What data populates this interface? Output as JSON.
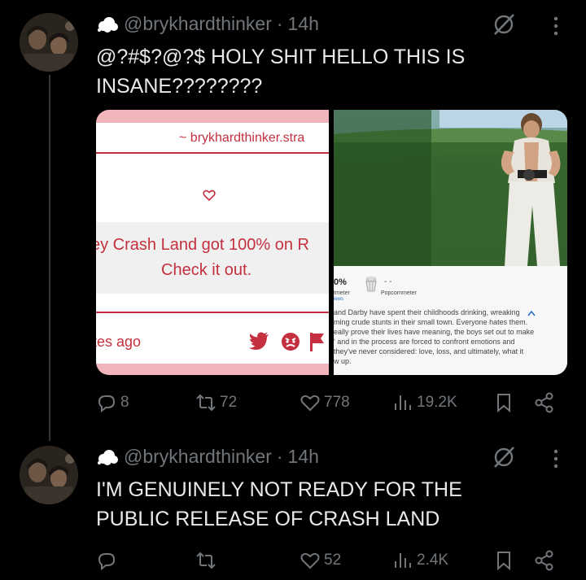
{
  "tweets": [
    {
      "handle": "@brykhardthinker",
      "separator": "·",
      "time": "14h",
      "lines": [
        "@?#$?@?$ HOLY SHIT HELLO THIS IS",
        "INSANE????????"
      ],
      "stats": {
        "replies": "8",
        "retweets": "72",
        "likes": "778",
        "views": "19.2K"
      }
    },
    {
      "handle": "@brykhardthinker",
      "separator": "·",
      "time": "14h",
      "lines": [
        "I'M GENUINELY NOT READY FOR THE",
        "PUBLIC RELEASE OF CRASH LAND"
      ],
      "stats": {
        "replies": "",
        "retweets": "",
        "likes": "52",
        "views": "2.4K"
      }
    }
  ],
  "media": {
    "left_card": {
      "handle_line": "~ brykhardthinker.stra",
      "message_line1": "ey Crash Land got 100% on R",
      "message_line2": "Check it out.",
      "time_line": "tes ago"
    },
    "right_panel": {
      "score": "0%",
      "score_label": "tmeter",
      "popcorn_score": "- -",
      "popcorn_label": "Popcornmeter",
      "reviews_label": "iews",
      "synopsis": [
        "and Darby have spent their childhoods drinking, wreaking",
        "ming crude stunts in their small town. Everyone hates them.",
        "eally prove their lives have meaning, the boys set out to make",
        "' and in the process are forced to confront emotions and",
        "they've never considered: love, loss, and ultimately, what it",
        "w up."
      ]
    }
  },
  "colors": {
    "background": "#000000",
    "text": "#e7e9ea",
    "muted": "#71767b",
    "card_red": "#c4303f",
    "card_pink": "#f2b5bc"
  }
}
